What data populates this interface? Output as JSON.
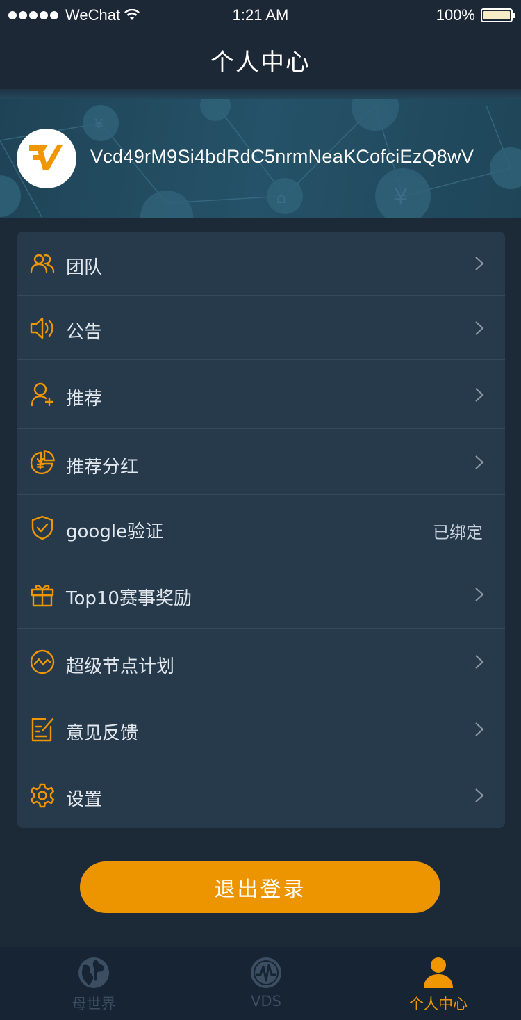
{
  "status_bar": {
    "carrier": "WeChat",
    "time": "1:21 AM",
    "battery": "100%"
  },
  "header": {
    "title": "个人中心"
  },
  "profile": {
    "username": "Vcd49rM9Si4bdRdC5nrmNeaKCofciEzQ8wV",
    "avatar_icon": "vds-logo-icon"
  },
  "menu": {
    "items": [
      {
        "label": "团队",
        "icon": "team-icon",
        "value": ""
      },
      {
        "label": "公告",
        "icon": "speaker-icon",
        "value": ""
      },
      {
        "label": "推荐",
        "icon": "add-user-icon",
        "value": ""
      },
      {
        "label": "推荐分红",
        "icon": "yen-pie-icon",
        "value": ""
      },
      {
        "label": "google验证",
        "icon": "shield-check-icon",
        "value": "已绑定"
      },
      {
        "label": "Top10赛事奖励",
        "icon": "gift-icon",
        "value": ""
      },
      {
        "label": "超级节点计划",
        "icon": "trend-icon",
        "value": ""
      },
      {
        "label": "意见反馈",
        "icon": "feedback-icon",
        "value": ""
      },
      {
        "label": "设置",
        "icon": "gear-icon",
        "value": ""
      }
    ]
  },
  "logout": {
    "label": "退出登录"
  },
  "tab_bar": {
    "tabs": [
      {
        "label": "母世界",
        "icon": "globe-icon",
        "active": false
      },
      {
        "label": "VDS",
        "icon": "vds-icon",
        "active": false
      },
      {
        "label": "个人中心",
        "icon": "person-icon",
        "active": true
      }
    ]
  },
  "colors": {
    "accent": "#ec9500",
    "background": "#1c2a38",
    "card": "#263a4c",
    "tab_inactive": "#3c4f62"
  }
}
